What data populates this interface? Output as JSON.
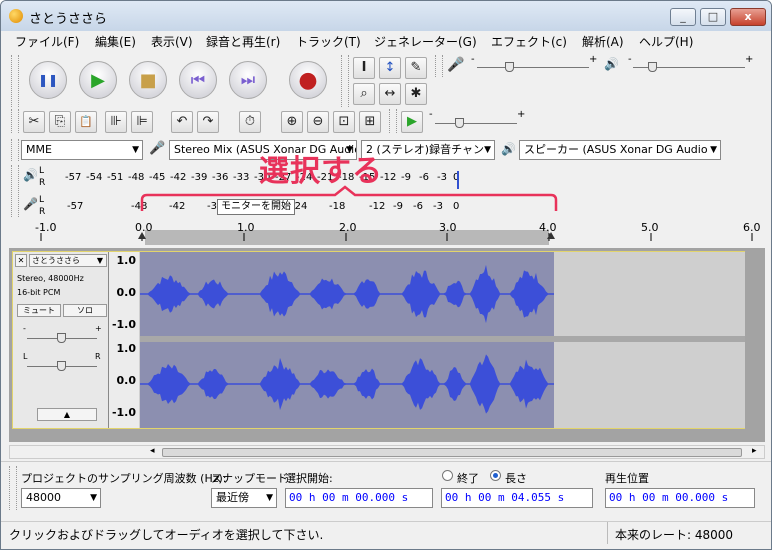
{
  "window": {
    "title": "さとうささら",
    "min": "_",
    "max": "□",
    "close": "x"
  },
  "menu": [
    "ファイル(F)",
    "編集(E)",
    "表示(V)",
    "録音と再生(r)",
    "トラック(T)",
    "ジェネレーター(G)",
    "エフェクト(c)",
    "解析(A)",
    "ヘルプ(H)"
  ],
  "transport": {
    "pause": "❚❚",
    "play": "▶",
    "stop": "■",
    "skip_start": "⏮",
    "skip_end": "⏭",
    "record": "●"
  },
  "tools": {
    "select": "I",
    "envelope": "↕",
    "draw": "✎",
    "zoom": "⌕",
    "timeshift": "↔",
    "multi": "✱"
  },
  "edit": {
    "cut": "✂",
    "copy": "⎘",
    "paste": "📋",
    "trim": "⊪",
    "silence": "⊫",
    "undo": "↶",
    "redo": "↷",
    "sync": "⏱",
    "zoom_in": "⊕",
    "zoom_out": "⊖",
    "fit_sel": "⊡",
    "fit": "⊞",
    "play_at_speed": "▶"
  },
  "device": {
    "host": "MME",
    "input": "Stereo Mix (ASUS Xonar DG Audio",
    "channels": "2 (ステレオ)録音チャン",
    "output": "スピーカー (ASUS Xonar DG Audio"
  },
  "meters": {
    "play_scale": [
      "-57",
      "-54",
      "-51",
      "-48",
      "-45",
      "-42",
      "-39",
      "-36",
      "-33",
      "-30",
      "-27",
      "-24",
      "-21",
      "-18",
      "-15",
      "-12",
      "-9",
      "-6",
      "-3",
      "0"
    ],
    "rec_scale": [
      "-57",
      "-48",
      "-42",
      "-36",
      "-24",
      "-18",
      "-12",
      "-9",
      "-6",
      "-3",
      "0"
    ],
    "tooltip": "モニターを開始"
  },
  "overlay": {
    "label": "選択する"
  },
  "ruler": {
    "ticks": [
      "-1.0",
      "0.0",
      "1.0",
      "2.0",
      "3.0",
      "4.0",
      "5.0",
      "6.0"
    ]
  },
  "track": {
    "name": "さとうささら",
    "rate": "Stereo, 48000Hz",
    "format": "16-bit PCM",
    "mute": "ミュート",
    "solo": "ソロ",
    "vscale": [
      "1.0",
      "0.0",
      "-1.0",
      "1.0",
      "0.0",
      "-1.0"
    ],
    "colors": {
      "wave": "#3c4fd8",
      "selected_bg": "#8c8fb0",
      "unselected_bg": "#cfcfcf",
      "frame": "#e2d46c"
    }
  },
  "selection_bar": {
    "project_rate_label": "プロジェクトのサンプリング周波数 (Hz):",
    "project_rate": "48000",
    "snap_label": "スナップモード",
    "snap_value": "最近傍",
    "sel_start_label": "選択開始:",
    "sel_start": "00 h 00 m 00.000 s",
    "end_label": "終了",
    "length_label": "長さ",
    "length_value": "00 h 00 m 04.055 s",
    "pos_label": "再生位置",
    "pos_value": "00 h 00 m 00.000 s"
  },
  "status": {
    "hint": "クリックおよびドラッグしてオーディオを選択して下さい.",
    "rate": "本来のレート: 48000"
  }
}
